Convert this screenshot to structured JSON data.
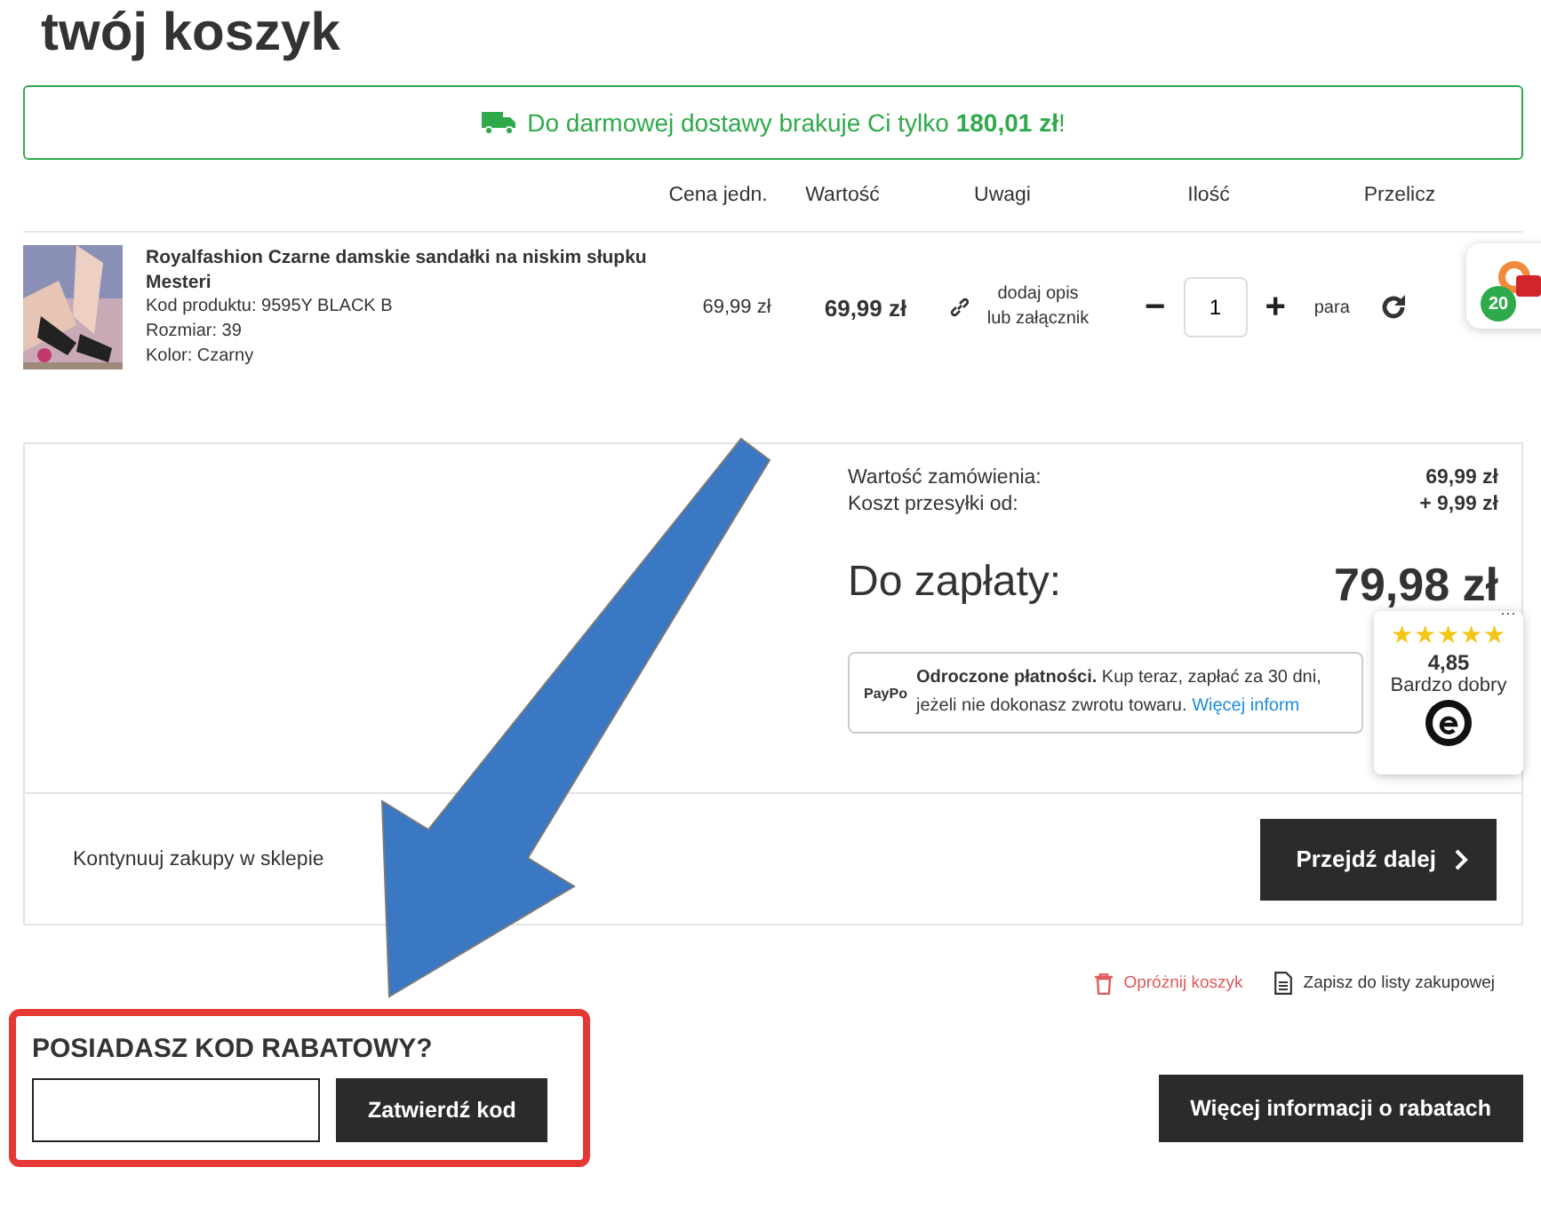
{
  "title": "twój koszyk",
  "shipping_banner": {
    "text": "Do darmowej dostawy brakuje Ci tylko **180,01 zł**!"
  },
  "table": {
    "columns": [
      "Cena jedn.",
      "Wartość",
      "Uwagi",
      "Ilość",
      "Przelicz"
    ],
    "rows": [
      {
        "kind": "picture",
        "name": "Royalfashion Czarne damskie sandałki na niskim słupku Mesteri",
        "details": [
          "Kod produktu: 9595Y BLACK B",
          "Rozmiar: 39",
          "Kolor: Czarny"
        ],
        "unit_price": "69,99 zł",
        "value": "69,99 zł",
        "note_link": "dodaj opis lub załącznik",
        "minus": "−",
        "quantity": "1",
        "plus": "+",
        "unit": "para"
      }
    ]
  },
  "summary": {
    "lines": [
      {
        "label": "Wartość zamówienia:",
        "value": "69,99 zł"
      },
      {
        "label": "Koszt przesyłki od:",
        "value": "+ 9,99 zł"
      }
    ],
    "total_label": "Do zapłaty:",
    "total_value": "79,98 zł",
    "paypo": {
      "logo": "PayPo",
      "text": "**Odroczone płatności.** Kup teraz, zapłać za 30 dni, jeżeli nie dokonasz zwrotu towaru.",
      "link": "Więcej inform"
    },
    "continue_link": "Kontynuuj zakupy w sklepie",
    "next_button": "Przejdź dalej"
  },
  "cart_actions": [
    "Opróżnij koszyk",
    "Zapisz do listy zakupowej"
  ],
  "discount": {
    "heading": "POSIADASZ KOD RABATOWY?",
    "apply_button": "Zatwierdź kod",
    "info_button": "Więcej informacji o rabatach"
  },
  "promo_badge": {
    "count": "20"
  },
  "rating_widget": {
    "stars": 5,
    "score": "4,85",
    "label": "Bardzo dobry",
    "menu": "···"
  }
}
